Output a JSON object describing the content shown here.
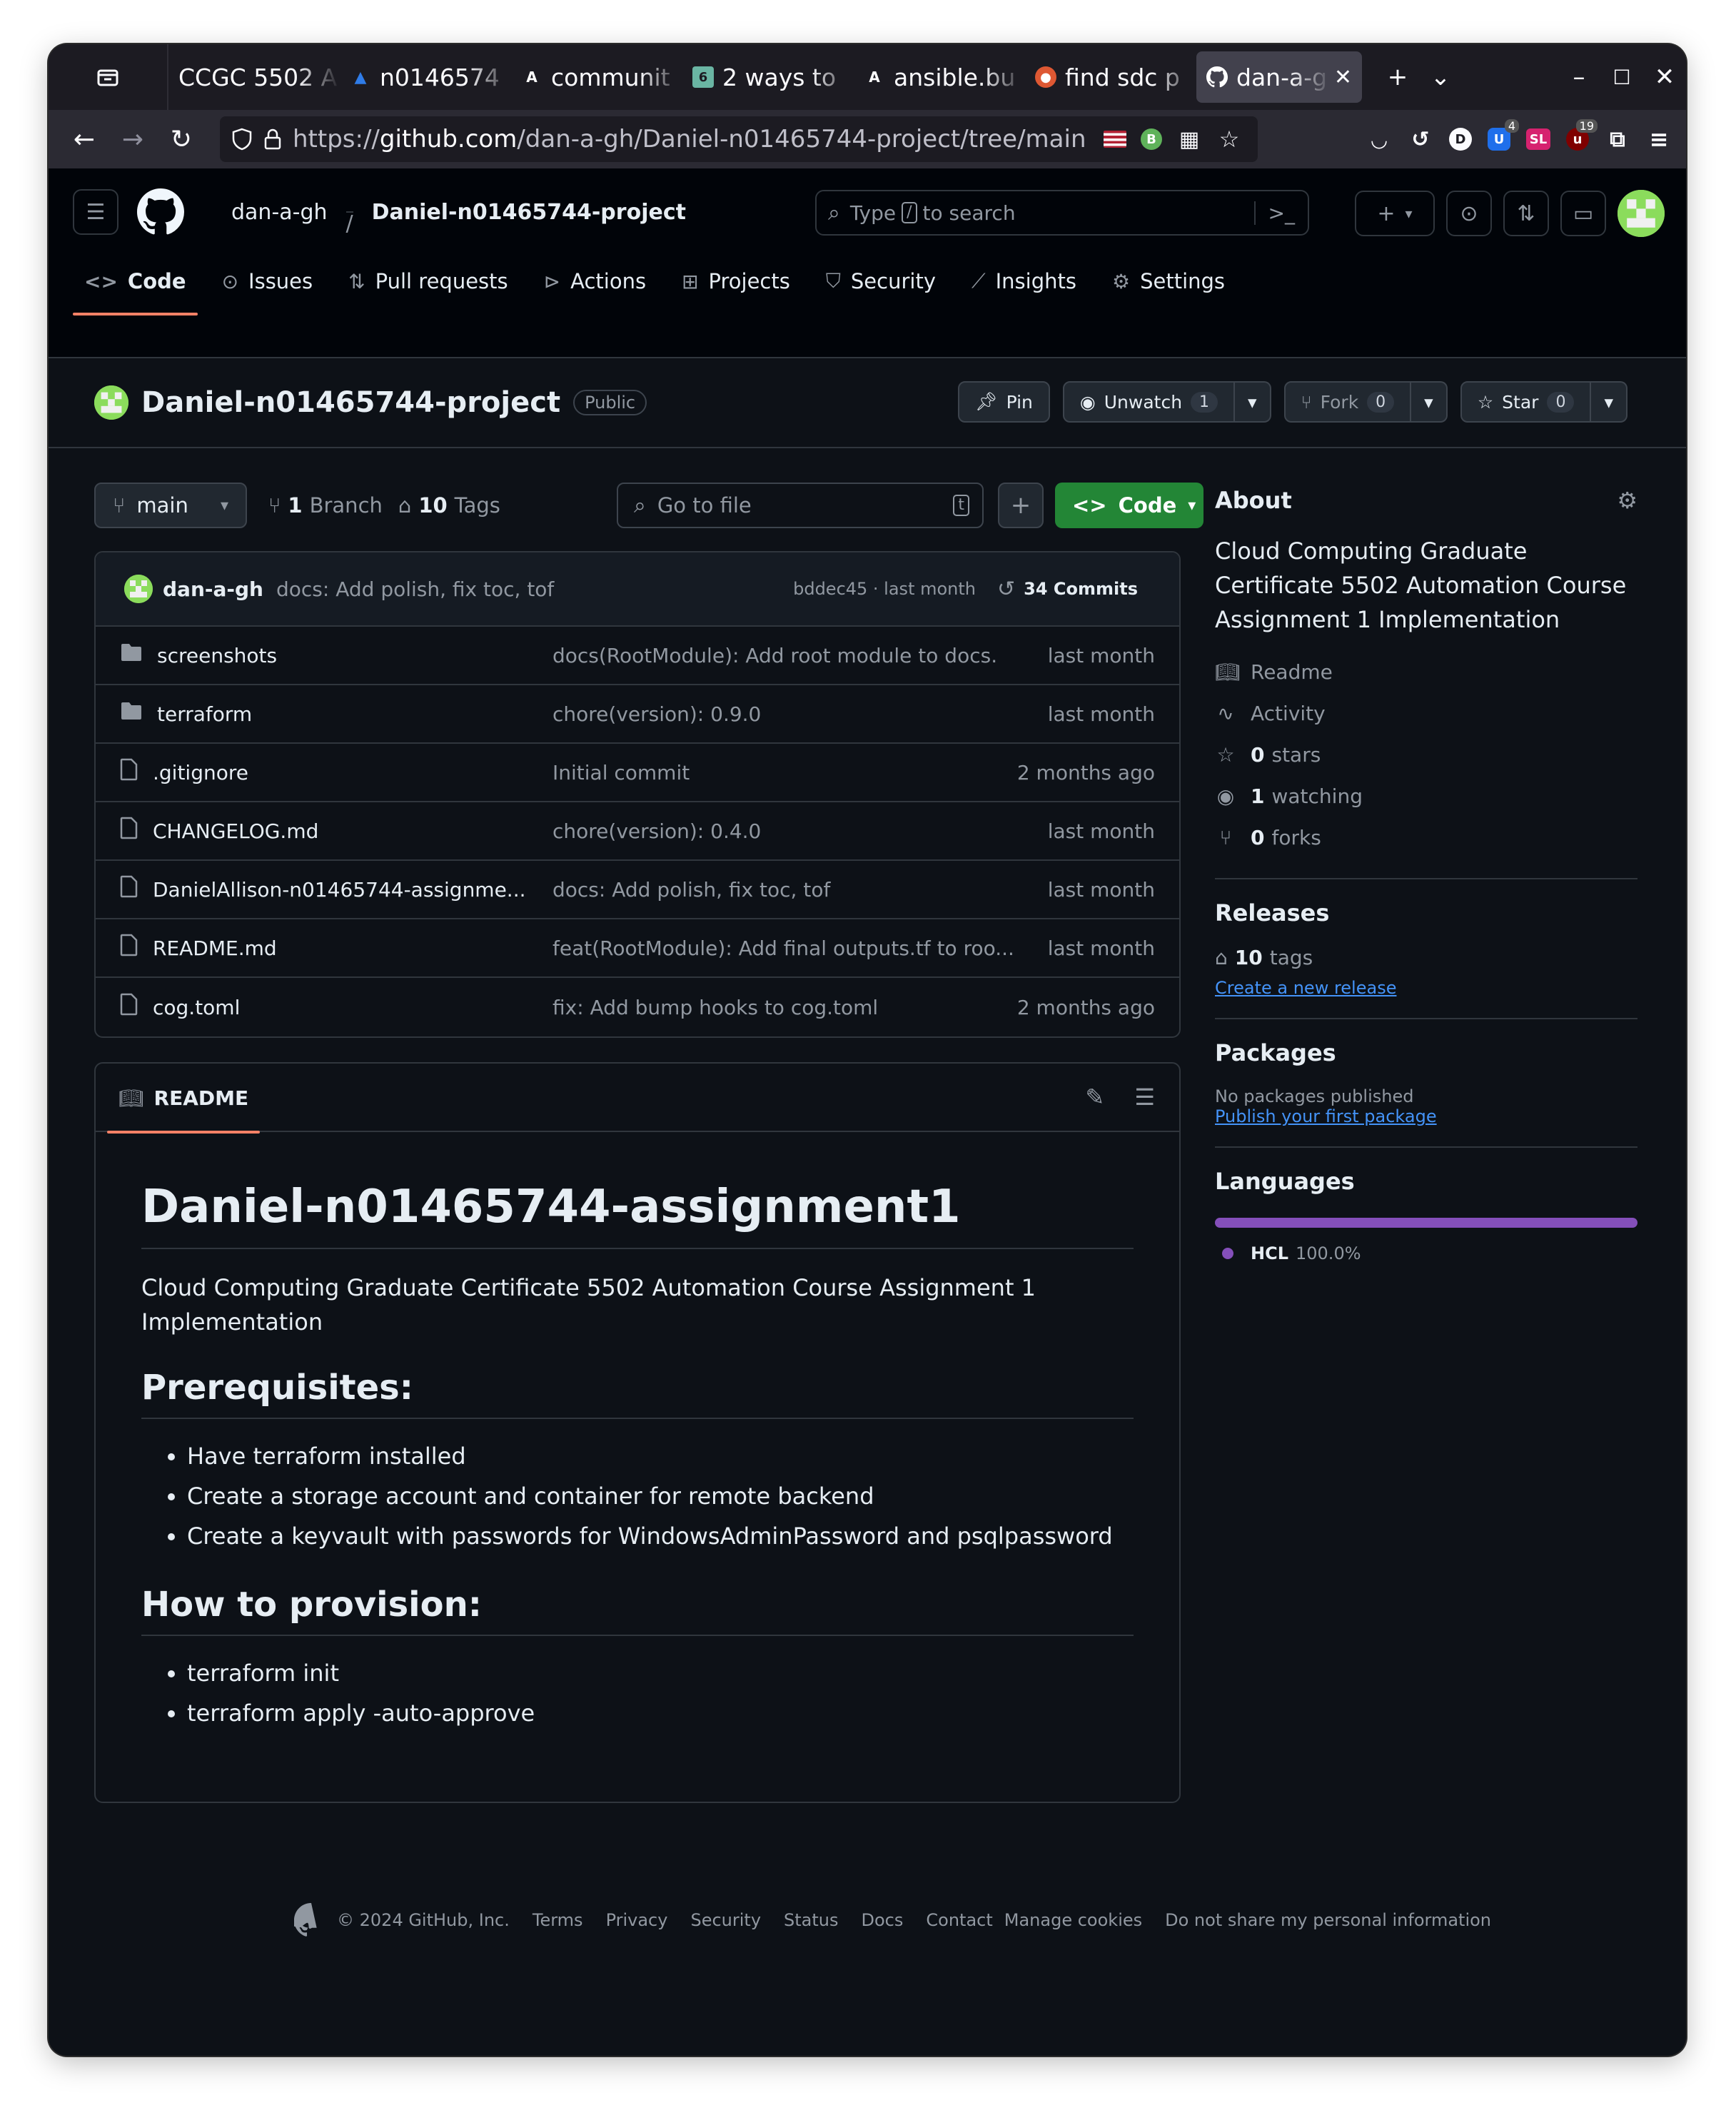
{
  "browser": {
    "tabs": [
      {
        "label": "CCGC 5502 A",
        "icon": "none",
        "color": "#fbfbfe"
      },
      {
        "label": "n0146574",
        "icon": "azure-icon",
        "color": "#2f7ce8"
      },
      {
        "label": "communit",
        "icon": "ansible-icon",
        "color": "#ffffff"
      },
      {
        "label": "2 ways to",
        "icon": "droplet-icon",
        "color": "#6ab5a3"
      },
      {
        "label": "ansible.bu",
        "icon": "ansible-icon",
        "color": "#ffffff"
      },
      {
        "label": "find sdc p",
        "icon": "duckduckgo-icon",
        "color": "#de5833"
      },
      {
        "label": "dan-a-g",
        "icon": "github-icon",
        "color": "#ffffff",
        "active": true
      }
    ],
    "url_prefix": "https://",
    "url_host": "github.com",
    "url_path": "/dan-a-gh/Daniel-n01465744-project/tree/main",
    "ext_badges": {
      "ublock": "4",
      "ublock_origin": "19"
    }
  },
  "github": {
    "owner": "dan-a-gh",
    "repo": "Daniel-n01465744-project",
    "crumb_sep": "/",
    "search": {
      "prefix": "Type",
      "key": "/",
      "suffix": "to search"
    },
    "nav": [
      "Code",
      "Issues",
      "Pull requests",
      "Actions",
      "Projects",
      "Security",
      "Insights",
      "Settings"
    ],
    "visibility": "Public",
    "actions": {
      "pin": "Pin",
      "unwatch": "Unwatch",
      "watch_count": "1",
      "fork": "Fork",
      "fork_count": "0",
      "star": "Star",
      "star_count": "0"
    }
  },
  "toolbar": {
    "branch": "main",
    "branch_count": "1",
    "branch_label": "Branch",
    "tag_count": "10",
    "tag_label": "Tags",
    "goto_placeholder": "Go to file",
    "goto_key": "t",
    "code_label": "Code"
  },
  "commit": {
    "user": "dan-a-gh",
    "message": "docs: Add polish, fix toc, tof",
    "hash_time": "bddec45 · last month",
    "count_label": "34 Commits"
  },
  "files": [
    {
      "type": "folder",
      "name": "screenshots",
      "message": "docs(RootModule): Add root module to docs.",
      "date": "last month"
    },
    {
      "type": "folder",
      "name": "terraform",
      "message": "chore(version): 0.9.0",
      "date": "last month"
    },
    {
      "type": "file",
      "name": ".gitignore",
      "message": "Initial commit",
      "date": "2 months ago"
    },
    {
      "type": "file",
      "name": "CHANGELOG.md",
      "message": "chore(version): 0.4.0",
      "date": "last month"
    },
    {
      "type": "file",
      "name": "DanielAllison-n01465744-assignme...",
      "message": "docs: Add polish, fix toc, tof",
      "date": "last month"
    },
    {
      "type": "file",
      "name": "README.md",
      "message": "feat(RootModule): Add final outputs.tf to roo...",
      "date": "last month"
    },
    {
      "type": "file",
      "name": "cog.toml",
      "message": "fix: Add bump hooks to cog.toml",
      "date": "2 months ago"
    }
  ],
  "readme": {
    "tab": "README",
    "h1": "Daniel-n01465744-assignment1",
    "intro": "Cloud Computing Graduate Certificate 5502 Automation Course Assignment 1 Implementation",
    "h2_prereq": "Prerequisites:",
    "prereqs": [
      "Have terraform installed",
      "Create a storage account and container for remote backend",
      "Create a keyvault with passwords for WindowsAdminPassword and psqlpassword"
    ],
    "h2_provision": "How to provision:",
    "provision": [
      "terraform init",
      "terraform apply -auto-approve"
    ]
  },
  "sidebar": {
    "about_title": "About",
    "about_desc": "Cloud Computing Graduate Certificate 5502 Automation Course Assignment 1 Implementation",
    "readme": "Readme",
    "activity": "Activity",
    "stars_n": "0",
    "stars": "stars",
    "watching_n": "1",
    "watching": "watching",
    "forks_n": "0",
    "forks": "forks",
    "releases_title": "Releases",
    "tags_n": "10",
    "tags": "tags",
    "create_release": "Create a new release",
    "packages_title": "Packages",
    "no_packages": "No packages published",
    "publish_package": "Publish your first package",
    "languages_title": "Languages",
    "lang_name": "HCL",
    "lang_pct": "100.0%",
    "lang_color": "#844fba"
  },
  "footer": {
    "copyright": "© 2024 GitHub, Inc.",
    "links": [
      "Terms",
      "Privacy",
      "Security",
      "Status",
      "Docs",
      "Contact",
      "Manage cookies",
      "Do not share my personal information"
    ]
  }
}
